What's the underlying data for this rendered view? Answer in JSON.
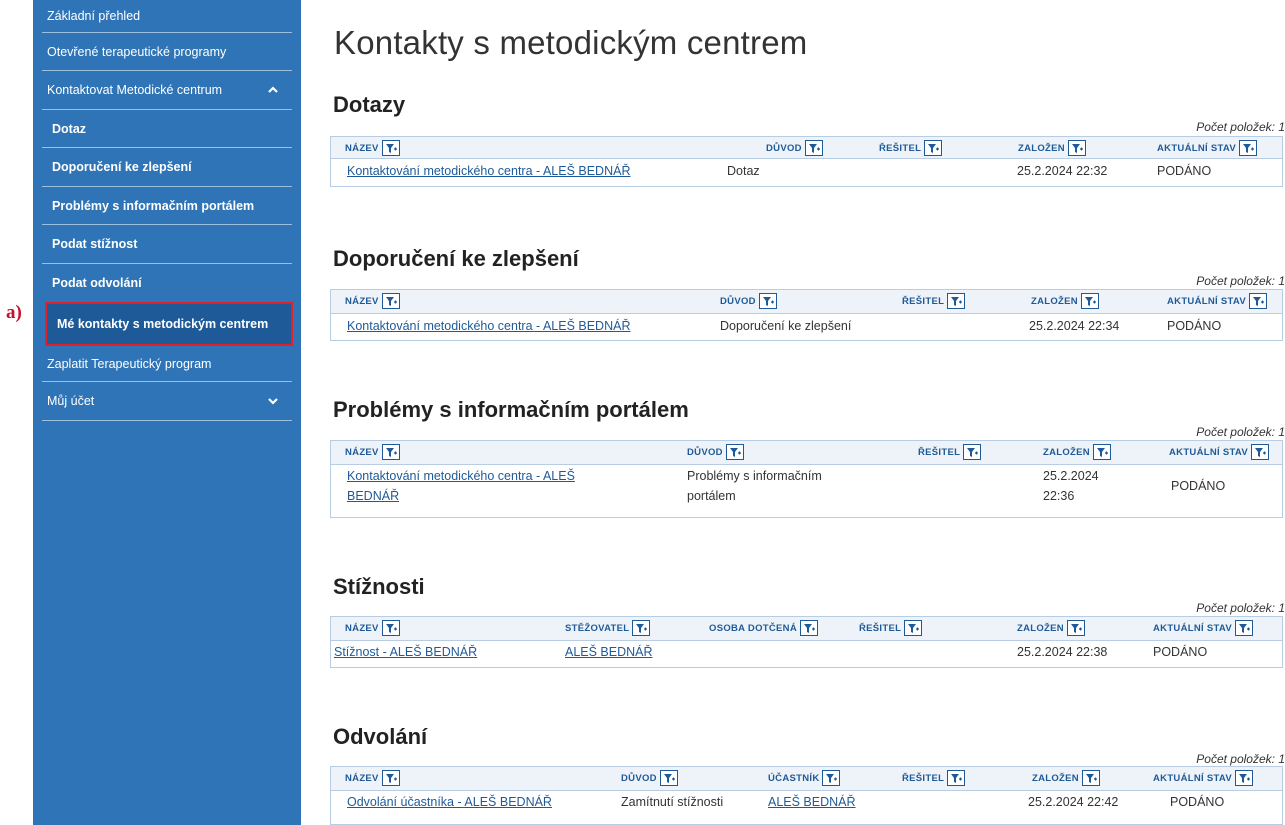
{
  "annotation": {
    "label": "a)"
  },
  "sidebar": {
    "items": [
      {
        "label": "Základní přehled"
      },
      {
        "label": "Otevřené terapeutické programy"
      },
      {
        "label": "Kontaktovat Metodické centrum"
      },
      {
        "label": "Dotaz"
      },
      {
        "label": "Doporučení ke zlepšení"
      },
      {
        "label": "Problémy s informačním portálem"
      },
      {
        "label": "Podat stížnost"
      },
      {
        "label": "Podat odvolání"
      },
      {
        "label": "Mé kontakty s metodickým centrem"
      },
      {
        "label": "Zaplatit Terapeutický program"
      },
      {
        "label": "Můj účet"
      }
    ]
  },
  "main": {
    "title": "Kontakty s metodickým centrem",
    "count_label": "Počet položek: 1",
    "sections": [
      {
        "title": "Dotazy",
        "headers": [
          "NÁZEV",
          "DŮVOD",
          "ŘEŠITEL",
          "ZALOŽEN",
          "AKTUÁLNÍ STAV"
        ],
        "row": {
          "name": "Kontaktování metodického centra - ALEŠ BEDNÁŘ",
          "reason": "Dotaz",
          "created": "25.2.2024 22:32",
          "state": "PODÁNO"
        }
      },
      {
        "title": "Doporučení ke zlepšení",
        "headers": [
          "NÁZEV",
          "DŮVOD",
          "ŘEŠITEL",
          "ZALOŽEN",
          "AKTUÁLNÍ STAV"
        ],
        "row": {
          "name": "Kontaktování metodického centra - ALEŠ BEDNÁŘ",
          "reason": "Doporučení ke zlepšení",
          "created": "25.2.2024 22:34",
          "state": "PODÁNO"
        }
      },
      {
        "title": "Problémy s informačním portálem",
        "headers": [
          "NÁZEV",
          "DŮVOD",
          "ŘEŠITEL",
          "ZALOŽEN",
          "AKTUÁLNÍ STAV"
        ],
        "row": {
          "name_line1": "Kontaktování metodického centra - ALEŠ",
          "name_line2": "BEDNÁŘ",
          "reason_line1": "Problémy s informačním",
          "reason_line2": "portálem",
          "created_line1": "25.2.2024",
          "created_line2": "22:36",
          "state": "PODÁNO"
        }
      },
      {
        "title": "Stížnosti",
        "headers": [
          "NÁZEV",
          "STĚŽOVATEL",
          "OSOBA DOTČENÁ",
          "ŘEŠITEL",
          "ZALOŽEN",
          "AKTUÁLNÍ STAV"
        ],
        "row": {
          "name": "Stížnost - ALEŠ BEDNÁŘ",
          "complainant": "ALEŠ BEDNÁŘ",
          "created": "25.2.2024 22:38",
          "state": "PODÁNO"
        }
      },
      {
        "title": "Odvolání",
        "headers": [
          "NÁZEV",
          "DŮVOD",
          "ÚČASTNÍK",
          "ŘEŠITEL",
          "ZALOŽEN",
          "AKTUÁLNÍ STAV"
        ],
        "row": {
          "name": "Odvolání účastníka - ALEŠ BEDNÁŘ",
          "reason": "Zamítnutí stížnosti",
          "participant": "ALEŠ BEDNÁŘ",
          "created": "25.2.2024 22:42",
          "state": "PODÁNO"
        }
      }
    ]
  },
  "colors": {
    "sidebar": "#2f74b6",
    "sidebar_active": "#1f5a98",
    "link": "#1f5a98",
    "highlight": "#e0202a"
  }
}
